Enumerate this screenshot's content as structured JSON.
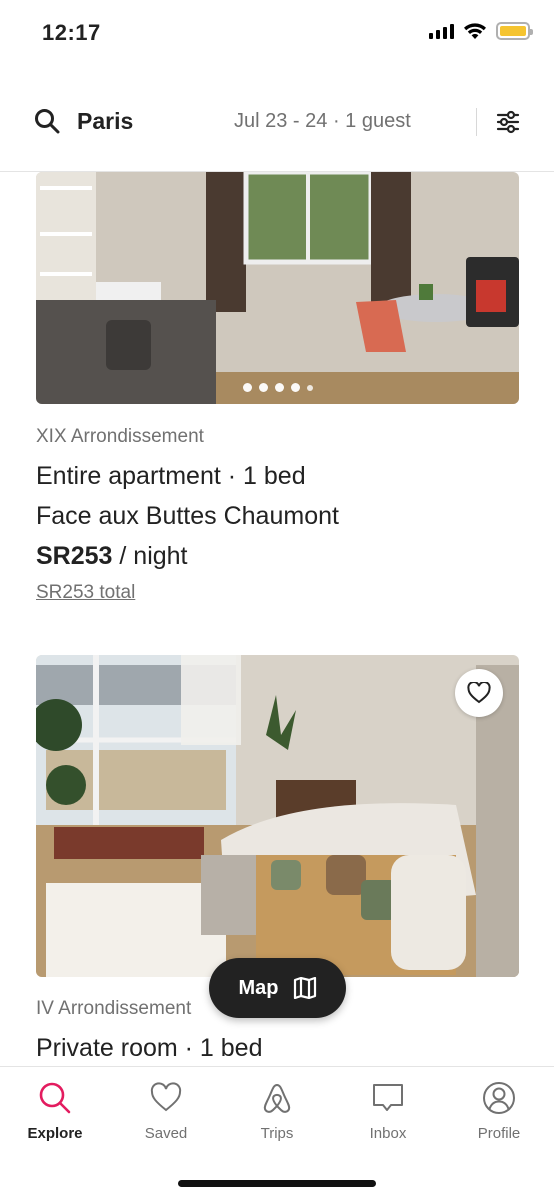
{
  "status": {
    "time": "12:17",
    "battery_color": "#f5c430"
  },
  "search": {
    "location": "Paris",
    "dates_guests": "Jul 23 - 24 · 1 guest"
  },
  "listings": [
    {
      "area": "XIX Arrondissement",
      "type": "Entire apartment · 1 bed",
      "title": "Face aux Buttes Chaumont",
      "price": "SR253",
      "price_unit": " / night",
      "total": "SR253 total",
      "photo_dots": 5
    },
    {
      "area": "IV Arrondissement",
      "type": "Private room · 1 bed"
    }
  ],
  "map_button": {
    "label": "Map",
    "icon": "map-icon"
  },
  "tabs": [
    {
      "label": "Explore",
      "icon": "search-icon",
      "active": true
    },
    {
      "label": "Saved",
      "icon": "heart-icon"
    },
    {
      "label": "Trips",
      "icon": "airbnb-logo-icon"
    },
    {
      "label": "Inbox",
      "icon": "message-icon"
    },
    {
      "label": "Profile",
      "icon": "profile-icon"
    }
  ],
  "colors": {
    "accent": "#e31c5f",
    "text": "#222222",
    "muted": "#717171"
  }
}
